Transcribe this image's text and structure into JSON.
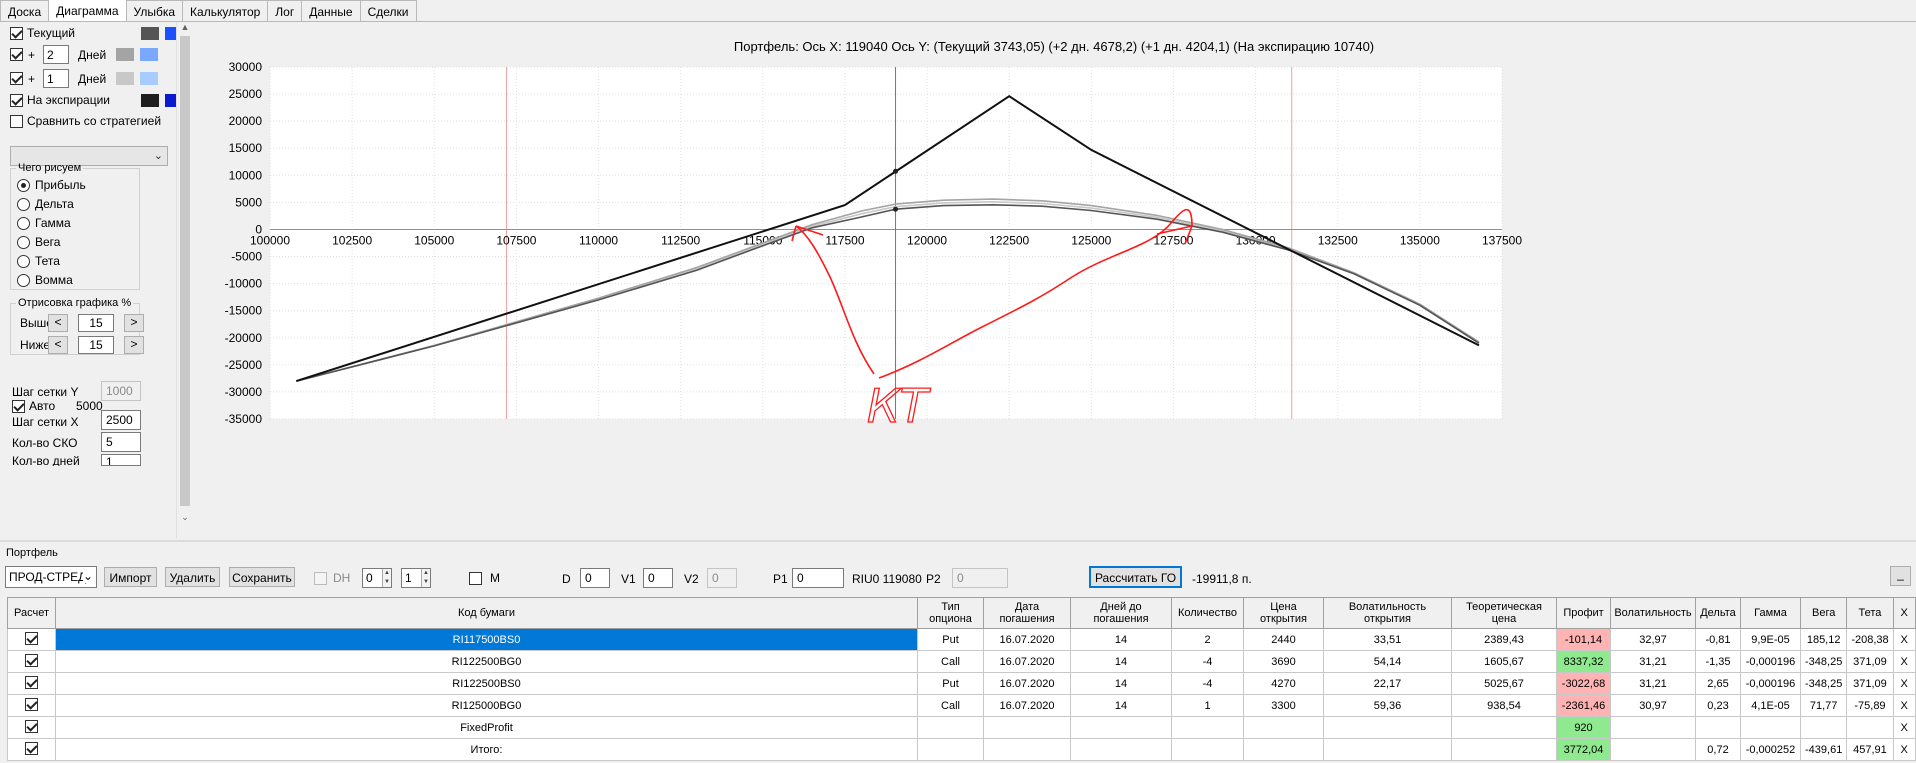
{
  "tabs": [
    "Доска",
    "Диаграмма",
    "Улыбка",
    "Калькулятор",
    "Лог",
    "Данные",
    "Сделки"
  ],
  "active_tab": "Диаграмма",
  "left_panel": {
    "current_label": "Текущий",
    "plus_label": "+",
    "days_label": "Дней",
    "days_1": "2",
    "days_2": "1",
    "expiry_label": "На экспирации",
    "compare_label": "Сравнить со стратегией",
    "colors": {
      "current": [
        "#555555",
        "#1a4fff"
      ],
      "days_1": [
        "#a4a4a4",
        "#7aa8ff"
      ],
      "days_2": [
        "#c8c8c8",
        "#a8ccff"
      ],
      "expiry": [
        "#1e1e1e",
        "#0a1acc"
      ]
    },
    "draw_group": "Чего рисуем",
    "draw_options": [
      "Прибыль",
      "Дельта",
      "Гамма",
      "Вега",
      "Тета",
      "Вомма"
    ],
    "selected_draw": "Прибыль",
    "render_group": "Отрисовка графика %",
    "above_label": "Выше",
    "above_value": "15",
    "below_label": "Ниже",
    "below_value": "15",
    "grid_y_label": "Шаг сетки Y",
    "grid_y_value": "1000",
    "auto_label": "Авто",
    "auto_value": "5000",
    "grid_x_label": "Шаг сетки X",
    "grid_x_value": "2500",
    "sko_label": "Кол-во СКО",
    "sko_value": "5",
    "days_count_label": "Кол-во дней",
    "days_count_value": "1"
  },
  "chart_title": "Портфель: Ось X: 119040 Ось Y:  (Текущий 3743,05)  (+2 дн. 4678,2)  (+1 дн. 4204,1)  (На экспирацию 10740)",
  "annotation_text": "КТ",
  "chart_data": {
    "type": "line",
    "xlim": [
      100000,
      137500
    ],
    "ylim": [
      -35000,
      30000
    ],
    "x_ticks": [
      "100000",
      "102500",
      "105000",
      "107500",
      "110000",
      "112500",
      "115000",
      "117500",
      "120000",
      "122500",
      "125000",
      "127500",
      "130000",
      "132500",
      "135000",
      "137500"
    ],
    "y_ticks": [
      "30000",
      "25000",
      "20000",
      "15000",
      "10000",
      "5000",
      "0",
      "-5000",
      "-10000",
      "-15000",
      "-20000",
      "-25000",
      "-30000",
      "-35000"
    ],
    "grid": true,
    "cursor_x": 119040,
    "red_verticals": [
      107200,
      131100
    ],
    "series": [
      {
        "name": "На экспирации",
        "color": "#111111",
        "points": [
          [
            100800,
            -28000
          ],
          [
            117500,
            4500
          ],
          [
            122500,
            24600
          ],
          [
            125000,
            14700
          ],
          [
            136800,
            -21400
          ]
        ]
      },
      {
        "name": "Текущий",
        "color": "#555555",
        "points": [
          [
            100800,
            -28000
          ],
          [
            105000,
            -21500
          ],
          [
            110000,
            -13000
          ],
          [
            113000,
            -7500
          ],
          [
            115000,
            -3000
          ],
          [
            116500,
            300
          ],
          [
            118000,
            2300
          ],
          [
            119040,
            3743
          ],
          [
            120500,
            4400
          ],
          [
            122000,
            4550
          ],
          [
            123500,
            4300
          ],
          [
            125000,
            3500
          ],
          [
            127000,
            1900
          ],
          [
            129000,
            -500
          ],
          [
            131000,
            -3800
          ],
          [
            133000,
            -8200
          ],
          [
            135000,
            -14000
          ],
          [
            136800,
            -21000
          ]
        ]
      },
      {
        "name": "+2 дн.",
        "color": "#a4a4a4",
        "points": [
          [
            100800,
            -28000
          ],
          [
            105000,
            -21400
          ],
          [
            110000,
            -12700
          ],
          [
            113000,
            -7000
          ],
          [
            115000,
            -2500
          ],
          [
            116500,
            900
          ],
          [
            118000,
            3400
          ],
          [
            119040,
            4678
          ],
          [
            120500,
            5400
          ],
          [
            122000,
            5600
          ],
          [
            123500,
            5300
          ],
          [
            125000,
            4400
          ],
          [
            127000,
            2600
          ],
          [
            129000,
            0
          ],
          [
            131000,
            -3400
          ],
          [
            133000,
            -8000
          ],
          [
            135000,
            -13800
          ],
          [
            136800,
            -20800
          ]
        ]
      },
      {
        "name": "+1 дн.",
        "color": "#c8c8c8",
        "points": [
          [
            100800,
            -28000
          ],
          [
            105000,
            -21450
          ],
          [
            110000,
            -12850
          ],
          [
            113000,
            -7250
          ],
          [
            115000,
            -2750
          ],
          [
            116500,
            600
          ],
          [
            118000,
            2900
          ],
          [
            119040,
            4204
          ],
          [
            120500,
            4900
          ],
          [
            122000,
            5100
          ],
          [
            123500,
            4800
          ],
          [
            125000,
            3950
          ],
          [
            127000,
            2250
          ],
          [
            129000,
            -250
          ],
          [
            131000,
            -3600
          ],
          [
            133000,
            -8100
          ],
          [
            135000,
            -13900
          ],
          [
            136800,
            -20900
          ]
        ]
      }
    ]
  },
  "portfolio": {
    "group_label": "Портфель",
    "portfolio_select": "ПРОД-СТРЕД",
    "import_label": "Импорт",
    "delete_label": "Удалить",
    "save_label": "Сохранить",
    "dh_label": "DH",
    "dh_value1": "0",
    "dh_value2": "1",
    "m_label": "M",
    "d_label": "D",
    "d_value": "0",
    "v1_label": "V1",
    "v1_value": "0",
    "v2_label": "V2",
    "v2_value": "0",
    "p1_label": "P1",
    "p1_value": "0",
    "riu_text": "RIU0 119080",
    "p2_label": "P2",
    "p2_value": "0",
    "calc_go_label": "Рассчитать ГО",
    "go_value": "-19911,8 п.",
    "min_button": "_"
  },
  "table": {
    "headers": [
      "Расчет",
      "Код бумаги",
      "Тип опциона",
      "Дата погашения",
      "Дней до погашения",
      "Количество",
      "Цена открытия",
      "Волатильность открытия",
      "Теоретическая цена",
      "Профит",
      "Волатильность",
      "Дельта",
      "Гамма",
      "Вега",
      "Тета",
      "X"
    ],
    "rows": [
      {
        "code": "RI117500BS0",
        "type": "Put",
        "date": "16.07.2020",
        "days": "14",
        "qty": "2",
        "open_price": "2440",
        "open_vol": "33,51",
        "theo": "2389,43",
        "profit": "-101,14",
        "vol": "32,97",
        "delta": "-0,81",
        "gamma": "9,9E-05",
        "vega": "185,12",
        "theta": "-208,38",
        "x": "X"
      },
      {
        "code": "RI122500BG0",
        "type": "Call",
        "date": "16.07.2020",
        "days": "14",
        "qty": "-4",
        "open_price": "3690",
        "open_vol": "54,14",
        "theo": "1605,67",
        "profit": "8337,32",
        "vol": "31,21",
        "delta": "-1,35",
        "gamma": "-0,000196",
        "vega": "-348,25",
        "theta": "371,09",
        "x": "X"
      },
      {
        "code": "RI122500BS0",
        "type": "Put",
        "date": "16.07.2020",
        "days": "14",
        "qty": "-4",
        "open_price": "4270",
        "open_vol": "22,17",
        "theo": "5025,67",
        "profit": "-3022,68",
        "vol": "31,21",
        "delta": "2,65",
        "gamma": "-0,000196",
        "vega": "-348,25",
        "theta": "371,09",
        "x": "X"
      },
      {
        "code": "RI125000BG0",
        "type": "Call",
        "date": "16.07.2020",
        "days": "14",
        "qty": "1",
        "open_price": "3300",
        "open_vol": "59,36",
        "theo": "938,54",
        "profit": "-2361,46",
        "vol": "30,97",
        "delta": "0,23",
        "gamma": "4,1E-05",
        "vega": "71,77",
        "theta": "-75,89",
        "x": "X"
      },
      {
        "code": "FixedProfit",
        "type": "",
        "date": "",
        "days": "",
        "qty": "",
        "open_price": "",
        "open_vol": "",
        "theo": "",
        "profit": "920",
        "vol": "",
        "delta": "",
        "gamma": "",
        "vega": "",
        "theta": "",
        "x": "X"
      },
      {
        "code": "Итого:",
        "type": "",
        "date": "",
        "days": "",
        "qty": "",
        "open_price": "",
        "open_vol": "",
        "theo": "",
        "profit": "3772,04",
        "vol": "",
        "delta": "0,72",
        "gamma": "-0,000252",
        "vega": "-439,61",
        "theta": "457,91",
        "x": "X"
      }
    ]
  }
}
